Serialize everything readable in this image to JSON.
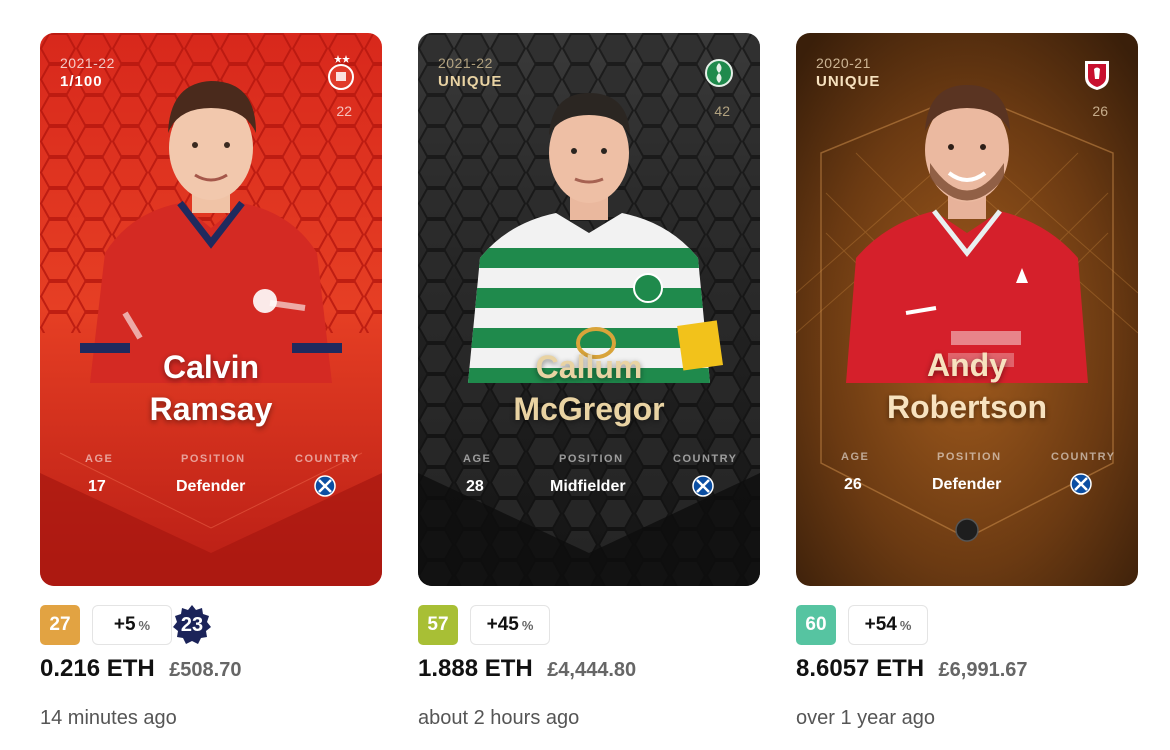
{
  "cards": [
    {
      "season": "2021-22",
      "serial": "1/100",
      "jersey_number": "22",
      "first_name": "Calvin",
      "last_name": "Ramsay",
      "labels": {
        "age": "AGE",
        "position": "POSITION",
        "country": "COUNTRY"
      },
      "age": "17",
      "position": "Defender",
      "score": "27",
      "score_color": "#e2a342",
      "delta": "+5",
      "delta_unit": "%",
      "badge": "23",
      "eth": "0.216 ETH",
      "fiat": "£508.70",
      "time": "14 minutes ago",
      "theme": "red"
    },
    {
      "season": "2021-22",
      "serial": "UNIQUE",
      "jersey_number": "42",
      "first_name": "Callum",
      "last_name": "McGregor",
      "labels": {
        "age": "AGE",
        "position": "POSITION",
        "country": "COUNTRY"
      },
      "age": "28",
      "position": "Midfielder",
      "score": "57",
      "score_color": "#a8bf35",
      "delta": "+45",
      "delta_unit": "%",
      "eth": "1.888 ETH",
      "fiat": "£4,444.80",
      "time": "about 2 hours ago",
      "theme": "black"
    },
    {
      "season": "2020-21",
      "serial": "UNIQUE",
      "jersey_number": "26",
      "first_name": "Andy",
      "last_name": "Robertson",
      "labels": {
        "age": "AGE",
        "position": "POSITION",
        "country": "COUNTRY"
      },
      "age": "26",
      "position": "Defender",
      "score": "60",
      "score_color": "#56c4a1",
      "delta": "+54",
      "delta_unit": "%",
      "eth": "8.6057 ETH",
      "fiat": "£6,991.67",
      "time": "over 1 year ago",
      "theme": "bronze"
    }
  ]
}
